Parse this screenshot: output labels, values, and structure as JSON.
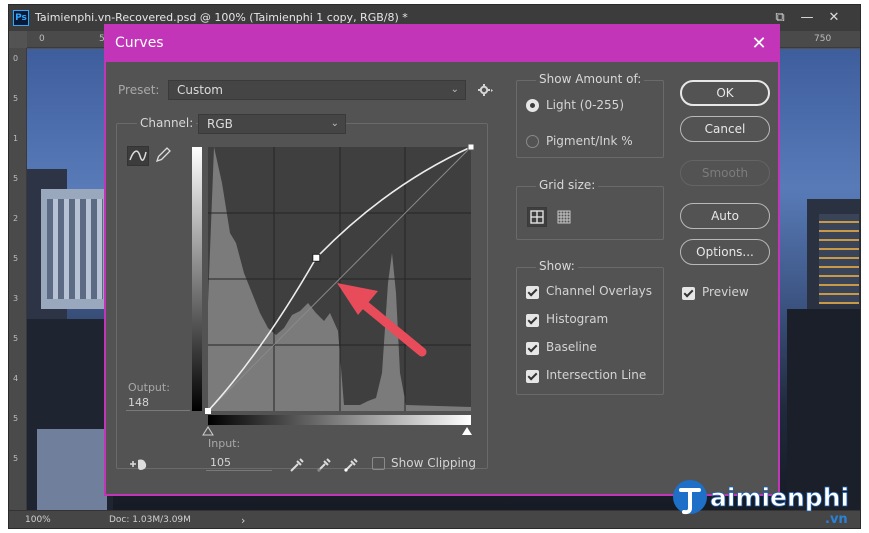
{
  "app": {
    "window_title": "Taimienphi.vn-Recovered.psd @ 100% (Taimienphi 1 copy, RGB/8) *",
    "ps_badge": "Ps",
    "controls": {
      "restore": "⧉",
      "minimize": "—",
      "maximize": "☐",
      "close": "✕"
    },
    "ruler_top": [
      "0",
      "50",
      "750"
    ],
    "ruler_left": [
      "0",
      "5",
      "1",
      "5",
      "2",
      "5",
      "3",
      "5",
      "4",
      "5",
      "5"
    ],
    "status": {
      "zoom": "100%",
      "doc": "Doc: 1.03M/3.09M",
      "arrow": "›"
    }
  },
  "dialog": {
    "title": "Curves",
    "close": "✕",
    "preset": {
      "label": "Preset:",
      "value": "Custom"
    },
    "channel": {
      "label": "Channel:",
      "value": "RGB"
    },
    "output": {
      "label": "Output:",
      "value": "148"
    },
    "input": {
      "label": "Input:",
      "value": "105"
    },
    "show_clipping": {
      "label": "Show Clipping",
      "checked": false
    },
    "show_amount": {
      "title": "Show Amount of:",
      "light": "Light  (0-255)",
      "pigment": "Pigment/Ink %",
      "selected": "light"
    },
    "grid_size": {
      "title": "Grid size:",
      "selected": "simple"
    },
    "show": {
      "title": "Show:",
      "items": [
        {
          "label": "Channel Overlays",
          "checked": true
        },
        {
          "label": "Histogram",
          "checked": true
        },
        {
          "label": "Baseline",
          "checked": true
        },
        {
          "label": "Intersection Line",
          "checked": true
        }
      ]
    },
    "buttons": {
      "ok": "OK",
      "cancel": "Cancel",
      "smooth": "Smooth",
      "auto": "Auto",
      "options": "Options..."
    },
    "preview": {
      "label": "Preview",
      "checked": true
    },
    "curve_point": {
      "input": 105,
      "output": 148
    },
    "colors": {
      "accent": "#c235b8",
      "arrow": "#e84c5a",
      "panel": "#535353"
    }
  },
  "watermark": {
    "brand": "aimienphi",
    "suffix": ".vn"
  }
}
